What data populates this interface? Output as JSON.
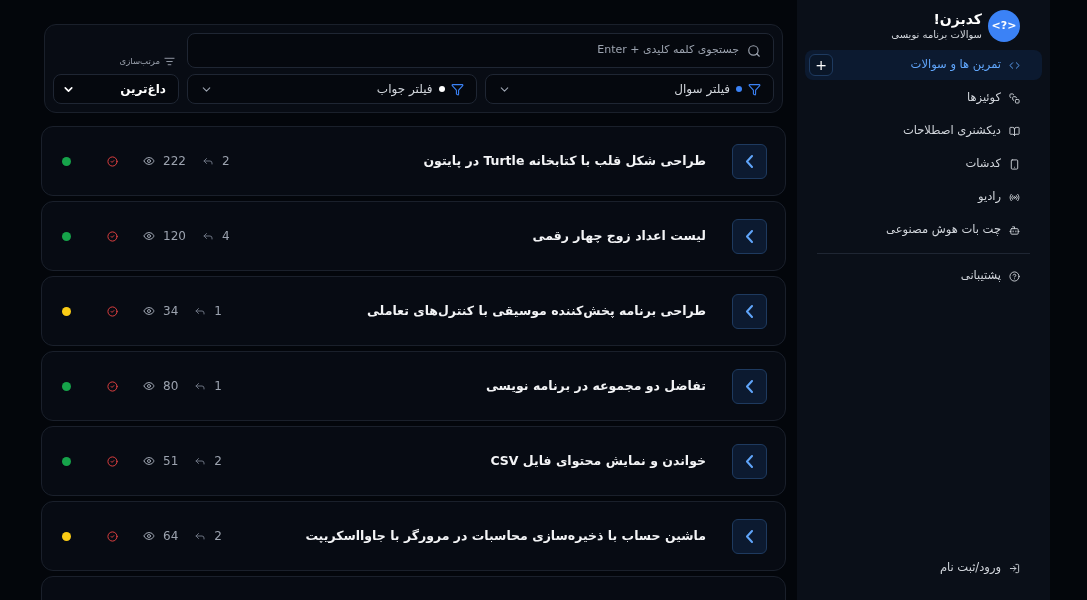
{
  "sidebar": {
    "logo_glyph": "<?>",
    "title": "کدبزن!",
    "subtitle": "سوالات برنامه نویسی",
    "items": [
      {
        "label": "تمرین ها و سوالات",
        "selected": true,
        "add_button": "+"
      },
      {
        "label": "کوئیزها",
        "selected": false
      },
      {
        "label": "دیکشنری اصطلاحات",
        "selected": false
      },
      {
        "label": "کدشات",
        "selected": false
      },
      {
        "label": "رادیو",
        "selected": false
      },
      {
        "label": "چت بات هوش مصنوعی",
        "selected": false
      }
    ],
    "support": {
      "label": "پشتیبانی"
    },
    "login": {
      "label": "ورود/ثبت نام"
    }
  },
  "filters": {
    "search": {
      "placeholder": "جستجوی کلمه کلیدی + Enter"
    },
    "question_filter": {
      "label": "فیلتر سوال",
      "color": "#3b82f6"
    },
    "answer_filter": {
      "label": "فیلتر جواب",
      "color": "#ffffff"
    },
    "sort": {
      "label": "مرتب‌سازی",
      "value": "داغ‌ترین"
    }
  },
  "questions": [
    {
      "title": "طراحی شکل قلب با کتابخانه Turtle در پایتون",
      "replies": "2",
      "views": "222",
      "color": "#16a34a"
    },
    {
      "title": "لیست اعداد زوج چهار رقمی",
      "replies": "4",
      "views": "120",
      "color": "#16a34a"
    },
    {
      "title": "طراحی برنامه پخش‌کننده موسیقی با کنترل‌های تعاملی",
      "replies": "1",
      "views": "34",
      "color": "#facc15"
    },
    {
      "title": "تفاضل دو مجموعه در برنامه نویسی",
      "replies": "1",
      "views": "80",
      "color": "#16a34a"
    },
    {
      "title": "خواندن و نمایش محتوای فایل CSV",
      "replies": "2",
      "views": "51",
      "color": "#16a34a"
    },
    {
      "title": "ماشین حساب با ذخیره‌سازی محاسبات در مرورگر با جاوااسکریپت",
      "replies": "2",
      "views": "64",
      "color": "#facc15"
    }
  ]
}
